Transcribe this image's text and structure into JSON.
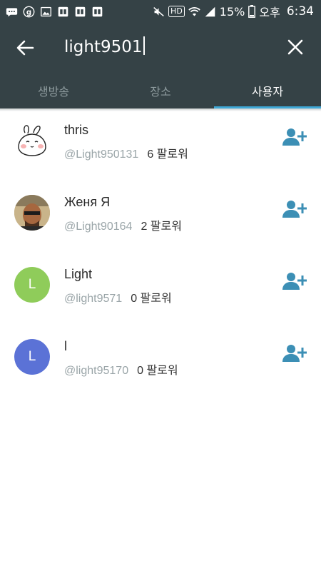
{
  "status_bar": {
    "battery": "15%",
    "ampm": "오후",
    "time": "6:34",
    "hd": "HD",
    "icons": [
      "message-icon",
      "g-circle-icon",
      "image-icon",
      "app-notif-icon",
      "app-notif-icon",
      "app-notif-icon",
      "mute-icon",
      "hd-icon",
      "wifi-icon",
      "signal-icon",
      "battery-icon"
    ]
  },
  "search": {
    "query": "light9501",
    "back_icon": "arrow-left-icon",
    "clear_icon": "close-icon"
  },
  "tabs": [
    {
      "label": "생방송",
      "active": false
    },
    {
      "label": "장소",
      "active": false
    },
    {
      "label": "사용자",
      "active": true
    }
  ],
  "users": [
    {
      "name": "thris",
      "handle": "@Light950131",
      "followers": "6 팔로워",
      "avatar": "rabbit-sticker"
    },
    {
      "name": "Женя Я",
      "handle": "@Light90164",
      "followers": "2 팔로워",
      "avatar": "photo"
    },
    {
      "name": "Light",
      "handle": "@light9571",
      "followers": "0 팔로워",
      "avatar_letter": "L",
      "avatar_color": "#8fcc5a"
    },
    {
      "name": "l",
      "handle": "@light95170",
      "followers": "0 팔로워",
      "avatar_letter": "L",
      "avatar_color": "#5b72d6"
    }
  ],
  "colors": {
    "header_bg": "#354246",
    "accent": "#3fa8d6",
    "follow_icon": "#3c8fb5"
  }
}
